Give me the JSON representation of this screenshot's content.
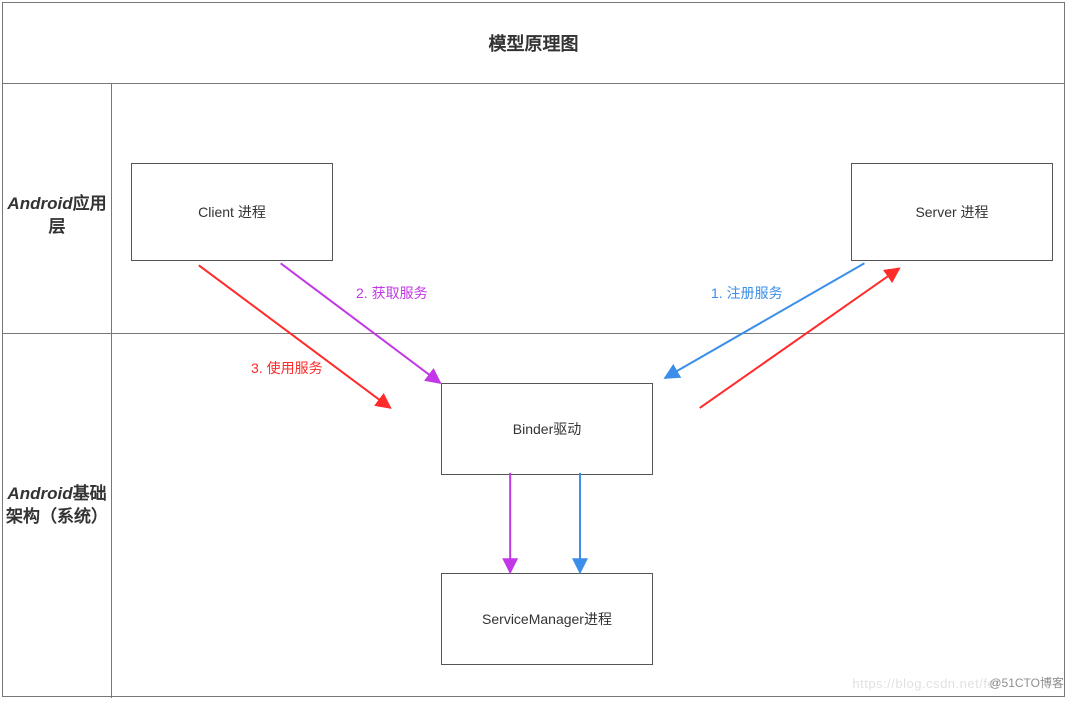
{
  "title": "模型原理图",
  "rows": {
    "app_layer_prefix": "Android",
    "app_layer_suffix": "应用层",
    "sys_layer_prefix": "Android",
    "sys_layer_suffix": "基础架构（系统）"
  },
  "nodes": {
    "client": "Client 进程",
    "server": "Server 进程",
    "binder": "Binder驱动",
    "service_manager": "ServiceManager进程"
  },
  "edges": {
    "register": "1. 注册服务",
    "lookup": "2. 获取服务",
    "use": "3. 使用服务"
  },
  "colors": {
    "register": "#3b8eea",
    "lookup": "#c238e6",
    "use": "#ff2a2a"
  },
  "watermark1": "https://blog.csdn.net/fer",
  "watermark2": "@51CTO博客"
}
